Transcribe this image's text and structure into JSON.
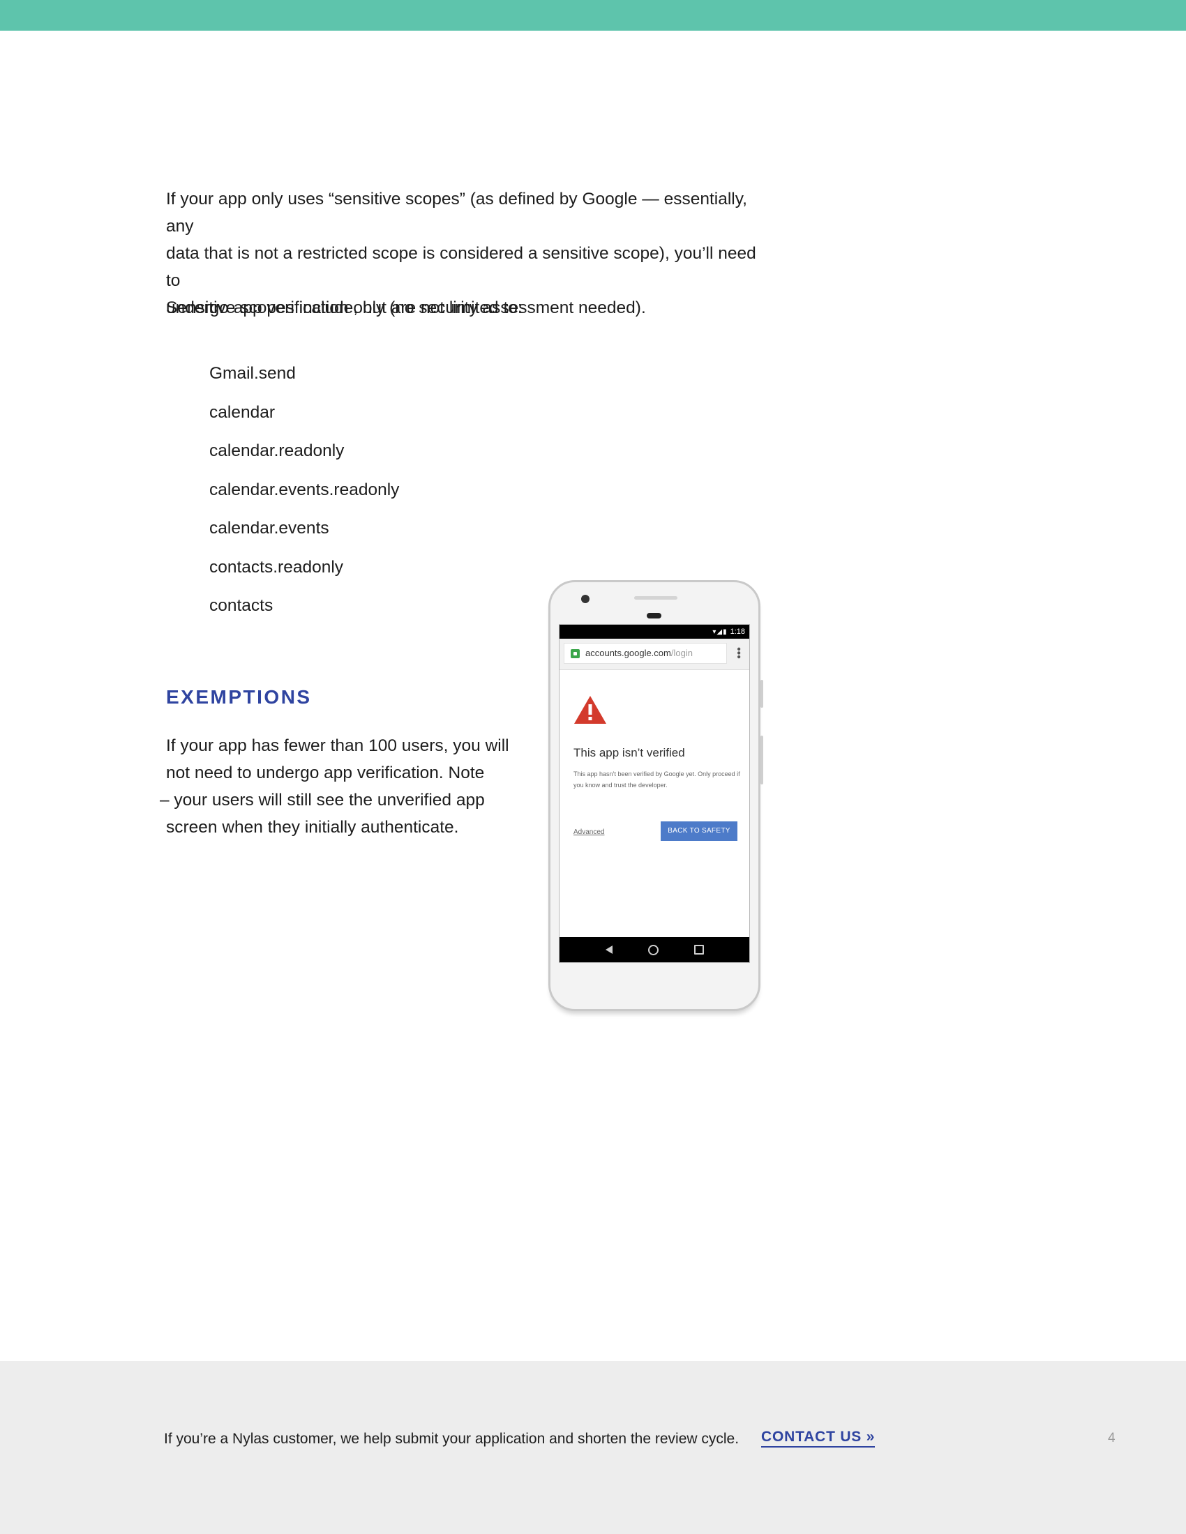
{
  "intro": {
    "line1": "If your app only uses “sensitive scopes” (as defined by Google — essentially, any",
    "line2": "data that is not a restricted scope is considered a sensitive scope), you’ll need to",
    "line3": "undergo app verification only (no security assessment needed)."
  },
  "scopes_lead": "Sensitive scopes include, but are not limited to:",
  "scopes": [
    "Gmail.send",
    "calendar",
    "calendar.readonly",
    "calendar.events.readonly",
    "calendar.events",
    "contacts.readonly",
    "contacts"
  ],
  "exemptions": {
    "heading": "EXEMPTIONS",
    "line1": "If your app has fewer than 100 users, you will",
    "line2": "not need to undergo app verification. Note",
    "line3": "– your users will still see the unverified app",
    "line4": "screen when they initially authenticate."
  },
  "phone": {
    "status_time": "1:18",
    "url_domain": "accounts.google.com",
    "url_path": "/login",
    "title": "This app isn’t verified",
    "description": "This app hasn’t been verified by Google yet. Only proceed if you know and trust the developer.",
    "advanced_label": "Advanced",
    "back_button_label": "BACK TO SAFETY",
    "icons": [
      "warning-icon",
      "lock-icon",
      "menu-icon",
      "back-icon",
      "home-icon",
      "recents-icon"
    ],
    "colors": {
      "warning": "#d33a2c",
      "button": "#4d7bc9",
      "lock": "#3aa64a"
    }
  },
  "footer": {
    "text": "If you’re a Nylas customer, we help submit your application and shorten the review cycle.",
    "contact_label": "CONTACT US »",
    "page_number": "4"
  },
  "colors": {
    "top_bar": "#5ec4ac",
    "heading": "#2f44a0",
    "footer_bg": "#ededed"
  }
}
